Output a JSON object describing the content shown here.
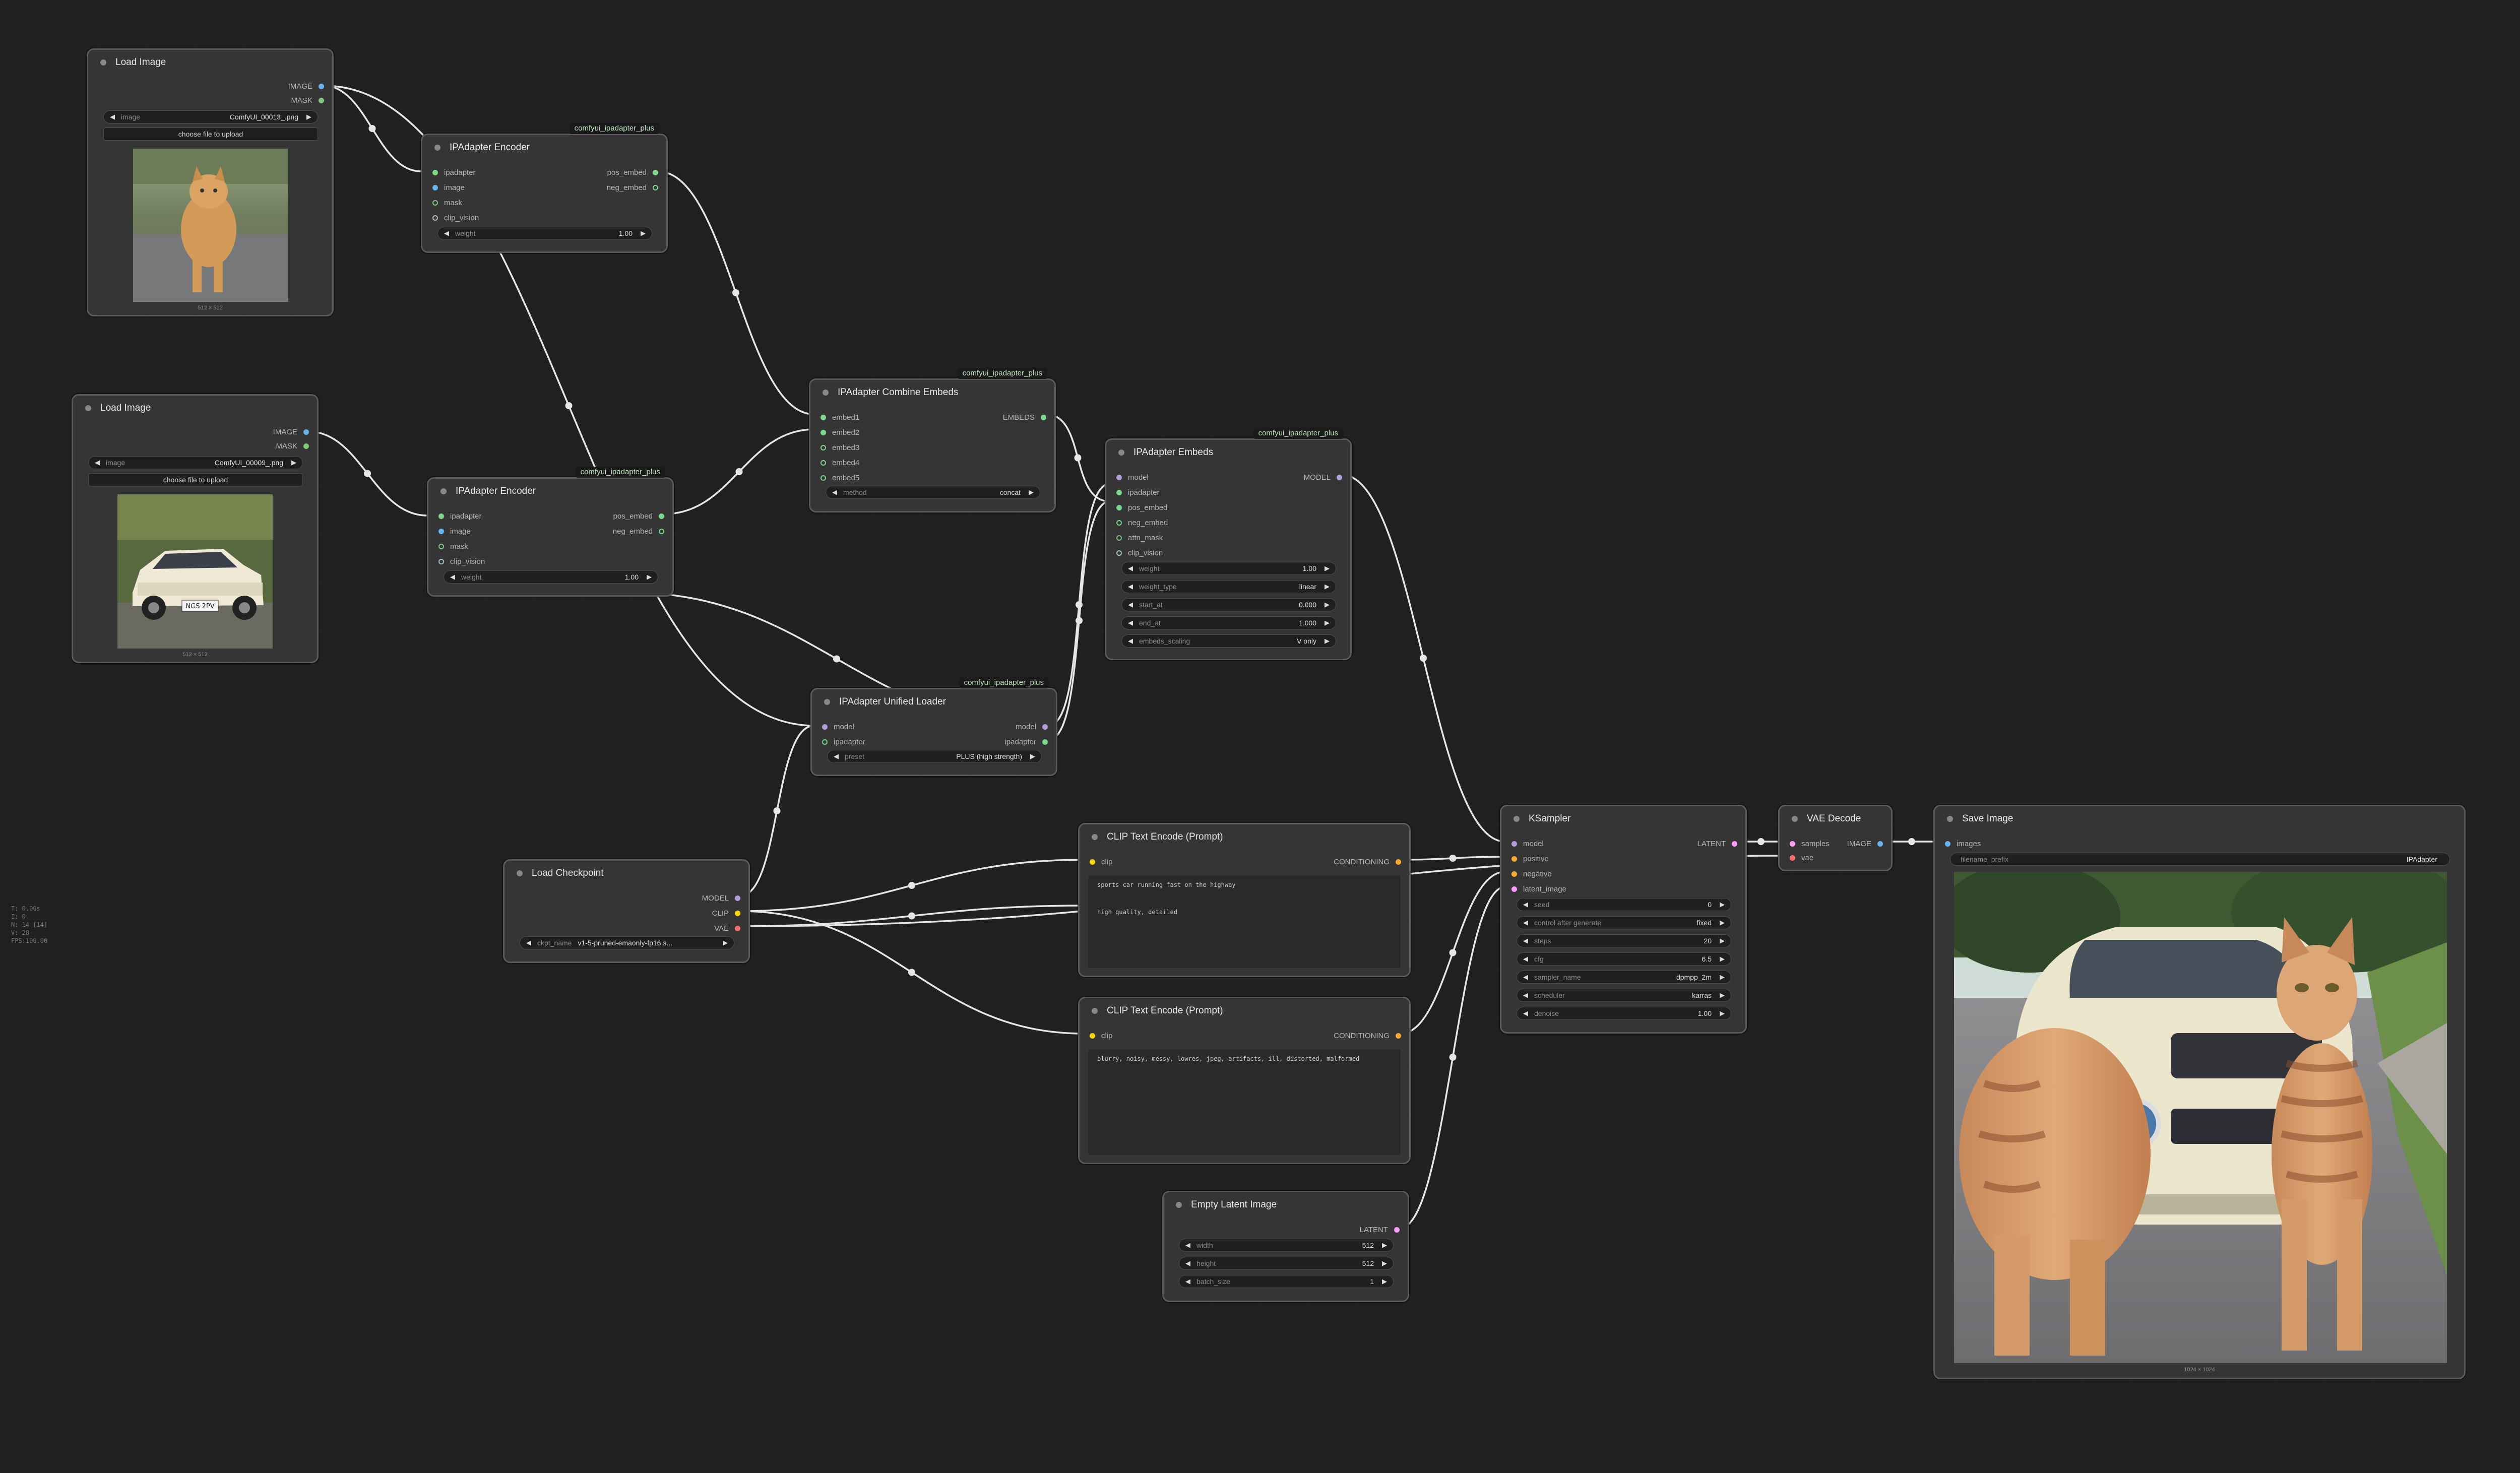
{
  "colors": {
    "canvas": "#202020",
    "node_bg": "#353535",
    "link": "#e6e6e6",
    "image": "#64b5f6",
    "mask": "#81c784",
    "latent": "#ff9cf9",
    "conditioning": "#ffa931",
    "clip": "#ffd500",
    "vae": "#ff6e6e",
    "model": "#b39ddb",
    "ipadapter": "#7bd88f",
    "embeds": "#7bd88f"
  },
  "stats": [
    "T: 0.00s",
    "I: 0",
    "N: 14 [14]",
    "V: 28",
    "FPS:100.00"
  ],
  "load_image_1": {
    "title": "Load Image",
    "outputs": [
      "IMAGE",
      "MASK"
    ],
    "image_label": "image",
    "image_value": "ComfyUI_00013_.png",
    "upload_label": "choose file to upload",
    "caption": "512 × 512"
  },
  "load_image_2": {
    "title": "Load Image",
    "outputs": [
      "IMAGE",
      "MASK"
    ],
    "image_label": "image",
    "image_value": "ComfyUI_00009_.png",
    "upload_label": "choose file to upload",
    "caption": "512 × 512",
    "plate_text": "NGS 2PV"
  },
  "encoder_1": {
    "title": "IPAdapter Encoder",
    "badge": "comfyui_ipadapter_plus",
    "inputs": [
      "ipadapter",
      "image",
      "mask",
      "clip_vision"
    ],
    "outputs": [
      "pos_embed",
      "neg_embed"
    ],
    "weight_label": "weight",
    "weight_value": "1.00"
  },
  "encoder_2": {
    "title": "IPAdapter Encoder",
    "badge": "comfyui_ipadapter_plus",
    "inputs": [
      "ipadapter",
      "image",
      "mask",
      "clip_vision"
    ],
    "outputs": [
      "pos_embed",
      "neg_embed"
    ],
    "weight_label": "weight",
    "weight_value": "1.00"
  },
  "combine": {
    "title": "IPAdapter Combine Embeds",
    "badge": "comfyui_ipadapter_plus",
    "inputs": [
      "embed1",
      "embed2",
      "embed3",
      "embed4",
      "embed5"
    ],
    "output": "EMBEDS",
    "method_label": "method",
    "method_value": "concat"
  },
  "embeds": {
    "title": "IPAdapter Embeds",
    "badge": "comfyui_ipadapter_plus",
    "inputs": [
      "model",
      "ipadapter",
      "pos_embed",
      "neg_embed",
      "attn_mask",
      "clip_vision"
    ],
    "output": "MODEL",
    "widgets": [
      {
        "label": "weight",
        "value": "1.00"
      },
      {
        "label": "weight_type",
        "value": "linear"
      },
      {
        "label": "start_at",
        "value": "0.000"
      },
      {
        "label": "end_at",
        "value": "1.000"
      },
      {
        "label": "embeds_scaling",
        "value": "V only"
      }
    ]
  },
  "unified_loader": {
    "title": "IPAdapter Unified Loader",
    "badge": "comfyui_ipadapter_plus",
    "inputs": [
      "model",
      "ipadapter"
    ],
    "outputs": [
      "model",
      "ipadapter"
    ],
    "preset_label": "preset",
    "preset_value": "PLUS (high strength)"
  },
  "checkpoint": {
    "title": "Load Checkpoint",
    "outputs": [
      "MODEL",
      "CLIP",
      "VAE"
    ],
    "ckpt_label": "ckpt_name",
    "ckpt_value": "v1-5-pruned-emaonly-fp16.s..."
  },
  "clip_pos": {
    "title": "CLIP Text Encode (Prompt)",
    "input": "clip",
    "output": "CONDITIONING",
    "text": "sports car running fast on the highway\n\n\nhigh quality, detailed"
  },
  "clip_neg": {
    "title": "CLIP Text Encode (Prompt)",
    "input": "clip",
    "output": "CONDITIONING",
    "text": "blurry, noisy, messy, lowres, jpeg, artifacts, ill, distorted, malformed"
  },
  "ksampler": {
    "title": "KSampler",
    "inputs": [
      "model",
      "positive",
      "negative",
      "latent_image"
    ],
    "output": "LATENT",
    "widgets": [
      {
        "label": "seed",
        "value": "0"
      },
      {
        "label": "control after generate",
        "value": "fixed"
      },
      {
        "label": "steps",
        "value": "20"
      },
      {
        "label": "cfg",
        "value": "6.5"
      },
      {
        "label": "sampler_name",
        "value": "dpmpp_2m"
      },
      {
        "label": "scheduler",
        "value": "karras"
      },
      {
        "label": "denoise",
        "value": "1.00"
      }
    ]
  },
  "vae_decode": {
    "title": "VAE Decode",
    "inputs": [
      "samples",
      "vae"
    ],
    "output": "IMAGE"
  },
  "empty_latent": {
    "title": "Empty Latent Image",
    "output": "LATENT",
    "widgets": [
      {
        "label": "width",
        "value": "512"
      },
      {
        "label": "height",
        "value": "512"
      },
      {
        "label": "batch_size",
        "value": "1"
      }
    ]
  },
  "save_image": {
    "title": "Save Image",
    "input": "images",
    "prefix_label": "filename_prefix",
    "prefix_value": "IPAdapter",
    "caption": "1024 × 1024"
  }
}
